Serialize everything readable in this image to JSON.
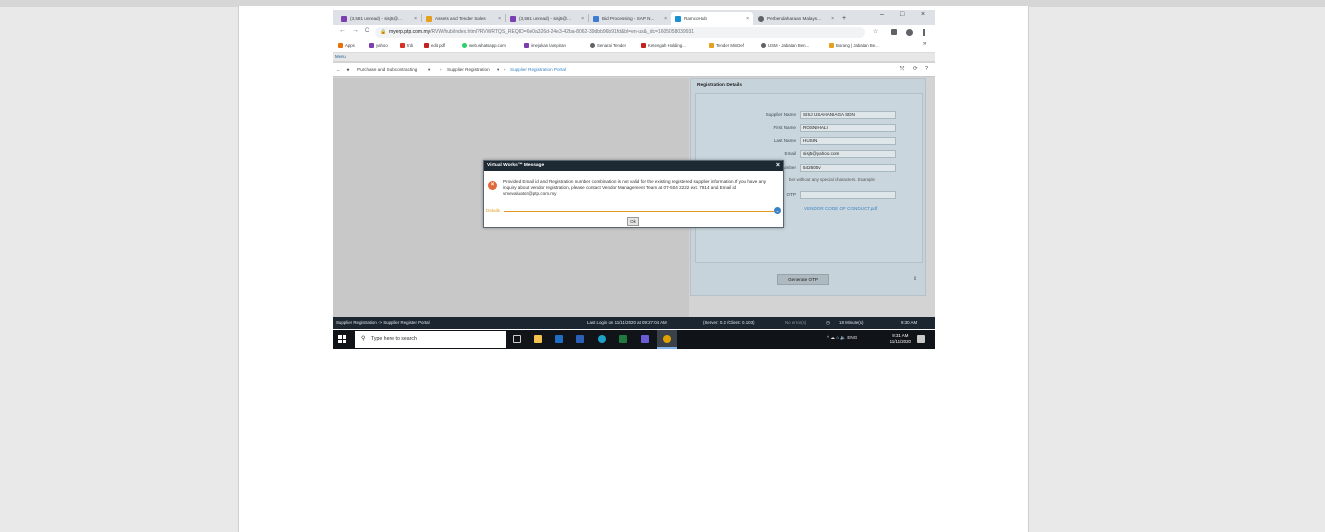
{
  "browser": {
    "tabs": [
      {
        "label": "(3,581 unread) - sisj5@...",
        "icon_color": "#7b3fb0"
      },
      {
        "label": "Assets and Tender Sales",
        "icon_color": "#e6a020"
      },
      {
        "label": "(3,581 unread) - sisj5@...",
        "icon_color": "#7b3fb0"
      },
      {
        "label": "Bid Processing - SAP N...",
        "icon_color": "#3d7bd6"
      },
      {
        "label": "RamcoHub",
        "icon_color": "#1a8fd6"
      },
      {
        "label": "Perbendaharaan Malays...",
        "icon_color": "#5f6368"
      }
    ],
    "new_tab_label": "+",
    "close_glyph": "×",
    "window_controls": {
      "minimize": "–",
      "maximize": "□",
      "close": "×"
    },
    "nav": {
      "back": "←",
      "forward": "→",
      "reload": "C"
    },
    "url_host": "myerp.ptp.com.my",
    "url_rest": "/RVW/hub/index.html?RVWRTQS_REQID=6e0a326d-24e3-42ba-8062-39dbb96b91fd&bl=en-us&_dc=1605058039931",
    "url_lock": "🔒",
    "star": "☆",
    "bookmarks": [
      {
        "label": "Apps",
        "color": "#e8710a"
      },
      {
        "label": "yahoo",
        "color": "#7b3fb0"
      },
      {
        "label": "tnb",
        "color": "#d93025"
      },
      {
        "label": "edit pdf",
        "color": "#c5221f"
      },
      {
        "label": "web.whatsapp.com",
        "color": "#25d366"
      },
      {
        "label": "imejukan lampiran",
        "color": "#7b3fb0"
      },
      {
        "label": "Senarai Tender",
        "color": "#5f6368"
      },
      {
        "label": "Ketengah Holding...",
        "color": "#c5221f"
      },
      {
        "label": "Tender MinDef",
        "color": "#e6a020"
      },
      {
        "label": "USM - Jabatan Ben...",
        "color": "#5f6368"
      },
      {
        "label": "Borang | Jabatan Be...",
        "color": "#e6a020"
      }
    ],
    "bookmarks_more": "»"
  },
  "app": {
    "menu_label": "Menu",
    "breadcrumb": {
      "back": "←",
      "home": "★",
      "module": "Purchase and Subcontracting",
      "sep": "›",
      "section": "Supplier Registration",
      "current": "Supplier Registration Portal"
    },
    "header_actions": {
      "expand": "⤲",
      "refresh": "⟳",
      "help": "?"
    },
    "panel": {
      "title": "Registration Details",
      "fields": [
        {
          "label": "Supplier Name",
          "value": "SISJ USAHANIAGA SDN"
        },
        {
          "label": "First Name",
          "value": "ROSNIHALI"
        },
        {
          "label": "Last Name",
          "value": "HUSIN"
        },
        {
          "label": "Email",
          "value": "sisj5@yahoo.com"
        },
        {
          "label": "Number",
          "value": "542600v"
        }
      ],
      "number_hint": "ber without any special characters. Example",
      "otp_label": "OTP",
      "otp_value": "",
      "conduct_link": "VENDOR CODE OF CONDUCT.pdf",
      "generate_button": "Generate OTP"
    },
    "statusbar": {
      "path": "Supplier Registration -> Supplier Register Portal",
      "last_login": "Last Login on 11/11/2020 at 09:27:04 AM",
      "server": "(Server: 0.2 /Client: 0.103)",
      "errors": "No error(s)",
      "session": "18 Minute(s)",
      "time": "9:30 AM"
    },
    "dialog": {
      "title": "Virtual Works™ Message",
      "close": "×",
      "error_glyph": "×",
      "message": "Provided Email id and Registration number combination is not valid for the existing registered supplier information.If you have any inquiry about vendor registration, please contact Vendor Management Team at 07-504 2222 ext. 7814 and Email id vmevaluator@ptp.com.my",
      "details_label": "Details",
      "chevron": "⌄",
      "ok_button": "Ok"
    }
  },
  "taskbar": {
    "search_placeholder": "Type here to search",
    "search_glyph": "⚲",
    "tray_text": "^ ☁ ⌂ 🔈 ENG",
    "clock_time": "9:31 AM",
    "clock_date": "11/11/2020"
  }
}
